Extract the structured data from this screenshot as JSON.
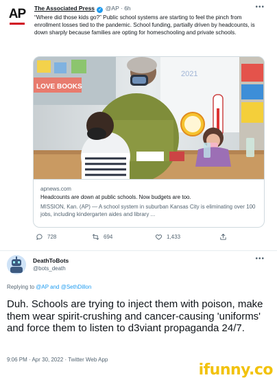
{
  "quoted_tweet": {
    "logo": "AP",
    "author_name": "The Associated Press",
    "verified_icon": "verified-badge-icon",
    "handle": "@AP",
    "separator": "·",
    "time": "6h",
    "text": "“Where did those kids go?” Public school systems are starting to feel the pinch from enrollment losses tied to the pandemic. School funding, partially driven by headcounts, is down sharply because families are opting for homeschooling and private schools.",
    "card": {
      "image_description_icon": "classroom-photo",
      "domain": "apnews.com",
      "title": "Headcounts are down at public schools. Now budgets are too.",
      "description": "MISSION, Kan. (AP) — A school system in suburban Kansas City is eliminating over 100 jobs, including kindergarten aides and library ..."
    },
    "actions": {
      "replies": "728",
      "retweets": "694",
      "likes": "1,433"
    }
  },
  "reply_tweet": {
    "author_name": "DeathToBots",
    "handle": "@bots_death",
    "replying_prefix": "Replying to",
    "replying_to": "@AP and @SethDillon",
    "text": "Duh.  Schools are trying to inject them with poison, make them wear spirit-crushing and cancer-causing 'uniforms' and force them to listen to d3viant propaganda 24/7.",
    "meta": "9:06 PM · Apr 30, 2022 · Twitter Web App"
  },
  "watermark": "ifunny.co",
  "colors": {
    "link_blue": "#1d9bf0",
    "muted_text": "#536471",
    "ap_red": "#d0021b",
    "watermark_yellow": "#f2c20c"
  }
}
